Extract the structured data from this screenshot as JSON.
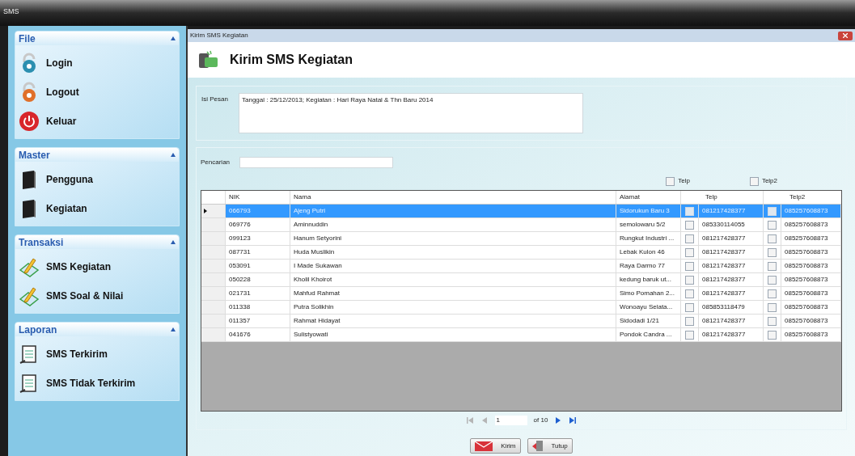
{
  "app_title": "SMS",
  "sidebar": [
    {
      "title": "File",
      "expanded": true,
      "items": [
        {
          "label": "Login",
          "kind": "lock_blue"
        },
        {
          "label": "Logout",
          "kind": "lock_orange"
        },
        {
          "label": "Keluar",
          "kind": "power"
        }
      ]
    },
    {
      "title": "Master",
      "expanded": true,
      "items": [
        {
          "label": "Pengguna",
          "kind": "book"
        },
        {
          "label": "Kegiatan",
          "kind": "book"
        }
      ]
    },
    {
      "title": "Transaksi",
      "expanded": true,
      "items": [
        {
          "label": "SMS Kegiatan",
          "kind": "pencil"
        },
        {
          "label": "SMS Soal & Nilai",
          "kind": "pencil"
        }
      ]
    },
    {
      "title": "Laporan",
      "expanded": true,
      "items": [
        {
          "label": "SMS Terkirim",
          "kind": "clipboard"
        },
        {
          "label": "SMS Tidak Terkirim",
          "kind": "clipboard"
        }
      ]
    }
  ],
  "window": {
    "title": "Kirim SMS Kegiatan",
    "heading": "Kirim SMS Kegiatan"
  },
  "message": {
    "label": "Isi Pesan",
    "value": "Tanggal : 25/12/2013; Kegiatan : Hari Raya Natal & Thn Baru 2014"
  },
  "search": {
    "label": "Pencarian"
  },
  "select_all": [
    {
      "label": "Telp",
      "checked": false
    },
    {
      "label": "Telp2",
      "checked": false
    }
  ],
  "table": {
    "columns": [
      "NIK",
      "Nama",
      "Alamat",
      "Telp",
      "Telp2"
    ],
    "rows": [
      {
        "nik": "066793",
        "nama": "Ajeng Putri",
        "alamat": "Sidorukun Baru 3",
        "telp_checked": false,
        "telp": "081217428377",
        "telp2_checked": false,
        "telp2": "085257608873",
        "selected": true
      },
      {
        "nik": "069776",
        "nama": "Aminnuddin",
        "alamat": "semolowaru 5/2",
        "telp_checked": false,
        "telp": "085330114055",
        "telp2_checked": false,
        "telp2": "085257608873",
        "selected": false
      },
      {
        "nik": "099123",
        "nama": "Hanum Setyorini",
        "alamat": "Rungkut Industri ...",
        "telp_checked": false,
        "telp": "081217428377",
        "telp2_checked": false,
        "telp2": "085257608873",
        "selected": false
      },
      {
        "nik": "087731",
        "nama": "Huda Muslikin",
        "alamat": "Lebak Kulon 46",
        "telp_checked": false,
        "telp": "081217428377",
        "telp2_checked": false,
        "telp2": "085257608873",
        "selected": false
      },
      {
        "nik": "053091",
        "nama": "I Made Sukawan",
        "alamat": "Raya Darmo 77",
        "telp_checked": false,
        "telp": "081217428377",
        "telp2_checked": false,
        "telp2": "085257608873",
        "selected": false
      },
      {
        "nik": "050228",
        "nama": "Kholil Khoirot",
        "alamat": "kedung baruk ut...",
        "telp_checked": false,
        "telp": "081217428377",
        "telp2_checked": false,
        "telp2": "085257608873",
        "selected": false
      },
      {
        "nik": "021731",
        "nama": "Mahfud Rahmat",
        "alamat": "Simo Pomahan 2...",
        "telp_checked": false,
        "telp": "081217428377",
        "telp2_checked": false,
        "telp2": "085257608873",
        "selected": false
      },
      {
        "nik": "011338",
        "nama": "Putra Solikhin",
        "alamat": "Wonoayu Selata...",
        "telp_checked": false,
        "telp": "085853118479",
        "telp2_checked": false,
        "telp2": "085257608873",
        "selected": false
      },
      {
        "nik": "011357",
        "nama": "Rahmat Hidayat",
        "alamat": "Sidodadi 1/21",
        "telp_checked": false,
        "telp": "081217428377",
        "telp2_checked": false,
        "telp2": "085257608873",
        "selected": false
      },
      {
        "nik": "041676",
        "nama": "Sulistyowati",
        "alamat": "Pondok Candra ...",
        "telp_checked": false,
        "telp": "081217428377",
        "telp2_checked": false,
        "telp2": "085257608873",
        "selected": false
      }
    ]
  },
  "pager": {
    "page": "1",
    "total": "of 10",
    "first_disabled": true,
    "prev_disabled": true,
    "next_disabled": false,
    "last_disabled": false
  },
  "buttons": [
    {
      "label": "Kirim",
      "kind": "mail"
    },
    {
      "label": "Tutup",
      "kind": "exit"
    }
  ]
}
